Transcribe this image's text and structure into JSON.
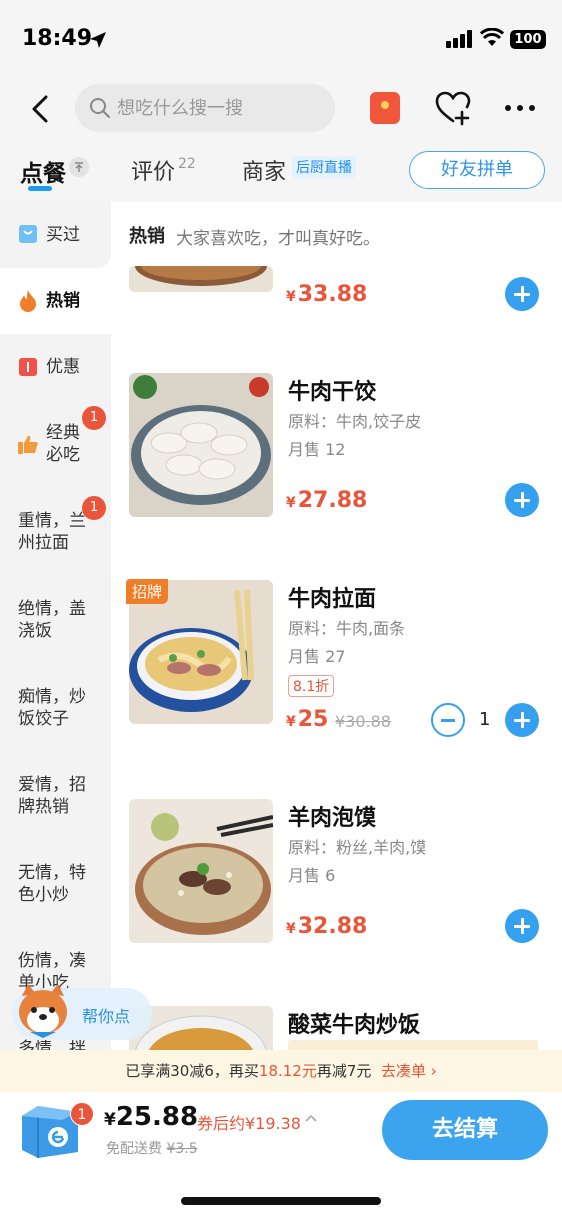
{
  "status": {
    "time": "18:49",
    "battery": "100"
  },
  "header": {
    "search_placeholder": "想吃什么搜一搜"
  },
  "tabs": {
    "order": "点餐",
    "reviews": "评价",
    "reviews_count": "22",
    "merchant": "商家",
    "live": "后厨直播",
    "group_order": "好友拼单"
  },
  "sidebar": {
    "items": [
      {
        "label": "买过"
      },
      {
        "label": "热销"
      },
      {
        "label": "优惠"
      },
      {
        "label": "经典必吃",
        "line1": "经典",
        "line2": "必吃",
        "badge": "1"
      },
      {
        "label": "重情，兰州拉面",
        "line1": "重情，兰",
        "line2": "州拉面",
        "badge": "1"
      },
      {
        "label": "绝情，盖浇饭",
        "line1": "绝情，盖",
        "line2": "浇饭"
      },
      {
        "label": "痴情，炒饭饺子",
        "line1": "痴情，炒",
        "line2": "饭饺子"
      },
      {
        "label": "爱情，招牌热销",
        "line1": "爱情，招",
        "line2": "牌热销"
      },
      {
        "label": "无情，特色小炒",
        "line1": "无情，特",
        "line2": "色小炒"
      },
      {
        "label": "伤情，凑单小吃",
        "line1": "伤情，凑",
        "line2": "单小吃"
      },
      {
        "label": "多情，拌",
        "line1": "多情，拌"
      }
    ]
  },
  "section": {
    "title": "热销",
    "subtitle": "大家喜欢吃，才叫真好吃。"
  },
  "items": [
    {
      "price": "33.88"
    },
    {
      "name": "牛肉干饺",
      "ingredients": "原料：牛肉,饺子皮",
      "sales": "月售 12",
      "price": "27.88"
    },
    {
      "name": "牛肉拉面",
      "ingredients": "原料：牛肉,面条",
      "sales": "月售 27",
      "discount": "8.1折",
      "price": "25",
      "original_price": "¥30.88",
      "quantity": "1",
      "badge": "招牌"
    },
    {
      "name": "羊肉泡馍",
      "ingredients": "原料：粉丝,羊肉,馍",
      "sales": "月售 6",
      "price": "32.88"
    },
    {
      "name": "酸菜牛肉炒饭"
    }
  ],
  "currency": "¥",
  "mascot": {
    "label": "帮你点"
  },
  "promo": {
    "text_a": "已享满30减6，再买",
    "amount": "18.12元",
    "text_b": "再减7元",
    "link": "去凑单 ›"
  },
  "footer": {
    "cart_count": "1",
    "total": "25.88",
    "coupon_price": "券后约¥19.38",
    "delivery_label": "免配送费",
    "delivery_original": "¥3.5",
    "checkout": "去结算"
  },
  "colors": {
    "accent": "#34a0ee",
    "price": "#e8553a",
    "promo_bg": "#fdf6e3"
  }
}
